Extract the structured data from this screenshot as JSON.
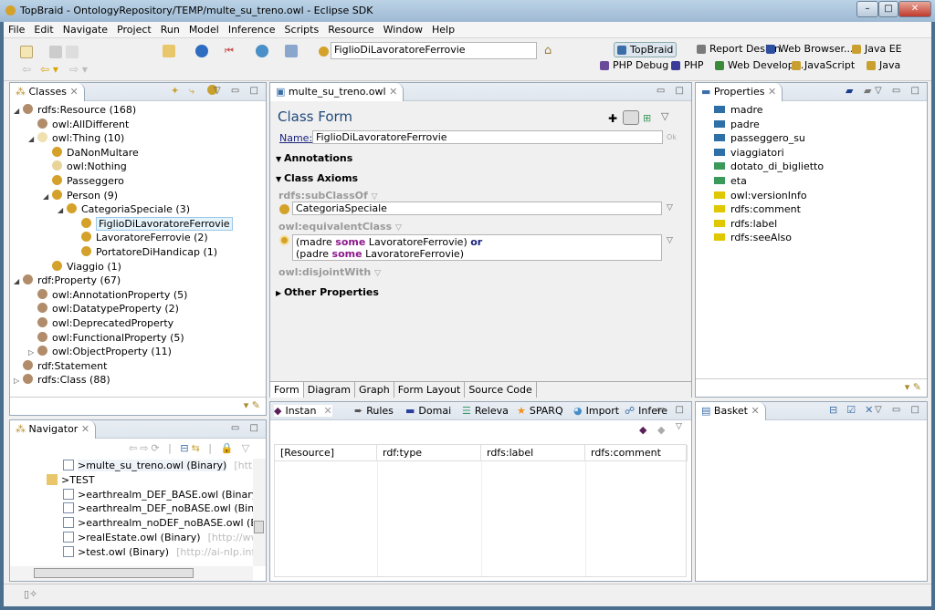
{
  "window": {
    "title": "TopBraid - OntologyRepository/TEMP/multe_su_treno.owl - Eclipse SDK"
  },
  "menu": [
    "File",
    "Edit",
    "Navigate",
    "Project",
    "Run",
    "Model",
    "Inference",
    "Scripts",
    "Resource",
    "Window",
    "Help"
  ],
  "toolbar": {
    "resource_field": "FiglioDiLavoratoreFerrovie"
  },
  "perspectives": [
    "TopBraid",
    "Report Design",
    "Web Browser...",
    "Java EE",
    "PHP Debug",
    "PHP",
    "Web Develop...",
    "JavaScript",
    "Java"
  ],
  "classes": {
    "tab": "Classes",
    "items": [
      {
        "label": "rdfs:Resource  (168)",
        "level": 0,
        "tw": "◢",
        "color": "#b08c6a"
      },
      {
        "label": "owl:AllDifferent",
        "level": 1,
        "tw": "",
        "color": "#b08c6a"
      },
      {
        "label": "owl:Thing  (10)",
        "level": 1,
        "tw": "◢",
        "color": "#efe0b0"
      },
      {
        "label": "DaNonMultare",
        "level": 2,
        "tw": "",
        "color": "#d4a12a"
      },
      {
        "label": "owl:Nothing",
        "level": 2,
        "tw": "",
        "color": "#e8d49a"
      },
      {
        "label": "Passeggero",
        "level": 2,
        "tw": "",
        "color": "#d4a12a"
      },
      {
        "label": "Person  (9)",
        "level": 2,
        "tw": "◢",
        "color": "#d4a12a"
      },
      {
        "label": "CategoriaSpeciale  (3)",
        "level": 3,
        "tw": "◢",
        "color": "#d4a12a"
      },
      {
        "label": "FiglioDiLavoratoreFerrovie",
        "level": 4,
        "tw": "",
        "color": "#d4a12a",
        "selected": true
      },
      {
        "label": "LavoratoreFerrovie  (2)",
        "level": 4,
        "tw": "",
        "color": "#d4a12a"
      },
      {
        "label": "PortatoreDiHandicap  (1)",
        "level": 4,
        "tw": "",
        "color": "#d4a12a"
      },
      {
        "label": "Viaggio  (1)",
        "level": 2,
        "tw": "",
        "color": "#d4a12a"
      },
      {
        "label": "rdf:Property  (67)",
        "level": 0,
        "tw": "◢",
        "color": "#b08c6a"
      },
      {
        "label": "owl:AnnotationProperty  (5)",
        "level": 1,
        "tw": "",
        "color": "#b08c6a"
      },
      {
        "label": "owl:DatatypeProperty  (2)",
        "level": 1,
        "tw": "",
        "color": "#b08c6a"
      },
      {
        "label": "owl:DeprecatedProperty",
        "level": 1,
        "tw": "",
        "color": "#b08c6a"
      },
      {
        "label": "owl:FunctionalProperty  (5)",
        "level": 1,
        "tw": "",
        "color": "#b08c6a"
      },
      {
        "label": "owl:ObjectProperty  (11)",
        "level": 1,
        "tw": "▷",
        "color": "#b08c6a"
      },
      {
        "label": "rdf:Statement",
        "level": 0,
        "tw": "",
        "color": "#b08c6a"
      },
      {
        "label": "rdfs:Class  (88)",
        "level": 0,
        "tw": "▷",
        "color": "#b08c6a"
      }
    ]
  },
  "navigator": {
    "tab": "Navigator",
    "items": [
      {
        "label": ">multe_su_treno.owl    (Binary)",
        "extra": "[http://a",
        "level": 1,
        "selected": true
      },
      {
        "label": ">TEST",
        "extra": "",
        "level": 0,
        "folder": true
      },
      {
        "label": ">earthrealm_DEF_BASE.owl    (Binary)",
        "extra": "[h",
        "level": 1
      },
      {
        "label": ">earthrealm_DEF_noBASE.owl    (Binary)",
        "extra": "",
        "level": 1
      },
      {
        "label": ">earthrealm_noDEF_noBASE.owl    (Binary)",
        "extra": "",
        "level": 1
      },
      {
        "label": ">realEstate.owl    (Binary)",
        "extra": "[http://www.to",
        "level": 1
      },
      {
        "label": ">test.owl    (Binary)",
        "extra": "[http://ai-nlp.info.u",
        "level": 1
      }
    ]
  },
  "editor": {
    "tab": "multe_su_treno.owl",
    "title": "Class Form",
    "name_label": "Name:",
    "name_value": "FiglioDiLavoratoreFerrovie",
    "ok": "Ok",
    "annotations": "Annotations",
    "class_axioms": "Class Axioms",
    "subclassof": "rdfs:subClassOf",
    "subclass_value": "CategoriaSpeciale",
    "equivalent": "owl:equivalentClass",
    "eq_line1": {
      "a": "(madre ",
      "some": "some",
      " b": "",
      "b": " LavoratoreFerrovie) ",
      "or": "or"
    },
    "eq_line2": {
      "a": "(padre ",
      "some": "some",
      "b": " LavoratoreFerrovie)"
    },
    "disjoint": "owl:disjointWith",
    "other": "Other Properties",
    "bottom_tabs": [
      "Form",
      "Diagram",
      "Graph",
      "Form Layout",
      "Source Code"
    ]
  },
  "instances": {
    "tabs": [
      "Instan",
      "Rules",
      "Domai",
      "Releva",
      "SPARQ",
      "Import",
      "Infere"
    ],
    "columns": [
      "[Resource]",
      "rdf:type",
      "rdfs:label",
      "rdfs:comment"
    ]
  },
  "properties": {
    "tab": "Properties",
    "items": [
      {
        "label": "madre",
        "color": "#2f6fa8"
      },
      {
        "label": "padre",
        "color": "#2f6fa8"
      },
      {
        "label": "passeggero_su",
        "color": "#2f6fa8"
      },
      {
        "label": "viaggiatori",
        "color": "#2f6fa8"
      },
      {
        "label": "dotato_di_biglietto",
        "color": "#3a9a5a"
      },
      {
        "label": "eta",
        "color": "#3a9a5a"
      },
      {
        "label": "owl:versionInfo",
        "color": "#e0c800"
      },
      {
        "label": "rdfs:comment",
        "color": "#e0c800"
      },
      {
        "label": "rdfs:label",
        "color": "#e0c800"
      },
      {
        "label": "rdfs:seeAlso",
        "color": "#e0c800"
      }
    ]
  },
  "basket": {
    "tab": "Basket"
  }
}
